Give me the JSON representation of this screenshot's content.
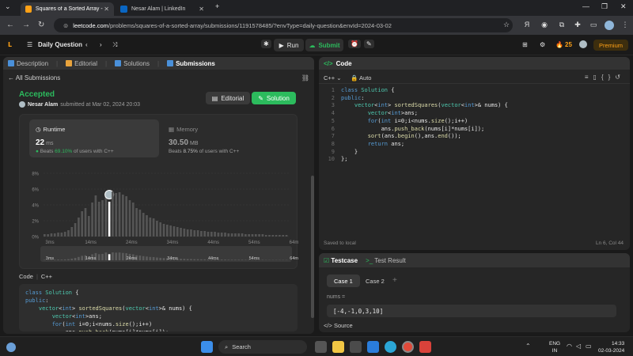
{
  "browser": {
    "tabs": [
      {
        "title": "Squares of a Sorted Array - Lee",
        "active": true
      },
      {
        "title": "Nesar Alam | LinkedIn",
        "active": false
      }
    ],
    "url_host": "leetcode.com",
    "url_path": "/problems/squares-of-a-sorted-array/submissions/1191578485/?envType=daily-question&envId=2024-03-02"
  },
  "nav": {
    "daily_label": "Daily Question",
    "run_label": "Run",
    "submit_label": "Submit",
    "streak": "25",
    "premium_label": "Premium"
  },
  "left_tabs": [
    {
      "label": "Description",
      "active": false
    },
    {
      "label": "Editorial",
      "active": false
    },
    {
      "label": "Solutions",
      "active": false
    },
    {
      "label": "Submissions",
      "active": true
    }
  ],
  "submission": {
    "back_label": "All Submissions",
    "status": "Accepted",
    "author": "Nesar Alam",
    "submitted_text": "submitted at Mar 02, 2024 20:03",
    "editorial_btn": "Editorial",
    "solution_btn": "Solution",
    "runtime": {
      "label": "Runtime",
      "value": "22",
      "unit": "ms",
      "beats_pre": "Beats",
      "beats_pct": "69.10%",
      "beats_post": "of users with C++"
    },
    "memory": {
      "label": "Memory",
      "value": "30.50",
      "unit": "MB",
      "beats_pre": "Beats",
      "beats_pct": "8.75%",
      "beats_post": "of users with C++"
    }
  },
  "chart_data": {
    "type": "bar",
    "yticks": [
      "8%",
      "6%",
      "4%",
      "2%",
      "0%"
    ],
    "ylim": [
      0,
      8
    ],
    "xticks": [
      "3ms",
      "14ms",
      "24ms",
      "34ms",
      "44ms",
      "54ms",
      "64ms"
    ],
    "highlight_index": 19,
    "values": [
      0.3,
      0.3,
      0.4,
      0.4,
      0.5,
      0.5,
      0.6,
      0.8,
      1.2,
      1.7,
      2.4,
      3.2,
      3.6,
      2.6,
      4.3,
      5.2,
      4.4,
      4.6,
      5.6,
      4.4,
      5.7,
      5.5,
      5.6,
      5.3,
      5.1,
      4.6,
      4.3,
      3.6,
      3.4,
      3.0,
      2.7,
      2.4,
      2.3,
      2.0,
      1.8,
      1.6,
      1.5,
      1.4,
      1.3,
      1.2,
      1.1,
      1.0,
      0.9,
      0.9,
      0.8,
      0.8,
      0.7,
      0.7,
      0.6,
      0.6,
      0.6,
      0.5,
      0.5,
      0.5,
      0.4,
      0.4,
      0.4,
      0.4,
      0.4,
      0.3,
      0.3,
      0.3,
      0.3,
      0.3,
      0.3,
      0.2,
      0.2,
      0.2,
      0.2,
      0.2,
      0.2,
      0.2
    ]
  },
  "left_code": {
    "header": "Code",
    "lang": "C++",
    "lines": [
      "class Solution {",
      "public:",
      "    vector<int> sortedSquares(vector<int>& nums) {",
      "        vector<int>ans;",
      "        for(int i=0;i<nums.size();i++)",
      "            ans.push_back(nums[i]*nums[i]);"
    ]
  },
  "editor": {
    "tab_label": "Code",
    "lang": "C++",
    "mode": "Auto",
    "lines": [
      "class Solution {",
      "public:",
      "    vector<int> sortedSquares(vector<int>& nums) {",
      "        vector<int>ans;",
      "        for(int i=0;i<nums.size();i++)",
      "            ans.push_back(nums[i]*nums[i]);",
      "        sort(ans.begin(),ans.end());",
      "        return ans;",
      "    }",
      "};"
    ],
    "saved_label": "Saved to local",
    "cursor": "Ln 6, Col 44"
  },
  "testcase": {
    "tab_label": "Testcase",
    "result_label": "Test Result",
    "cases": [
      "Case 1",
      "Case 2"
    ],
    "param_name": "nums =",
    "param_value": "[-4,-1,0,3,10]",
    "source_label": "Source"
  },
  "taskbar": {
    "search_label": "Search",
    "lang_line1": "ENG",
    "lang_line2": "IN",
    "time": "14:33",
    "date": "02-03-2024"
  },
  "colors": {
    "accent_green": "#2cbb5d",
    "orange": "#ffa116"
  }
}
